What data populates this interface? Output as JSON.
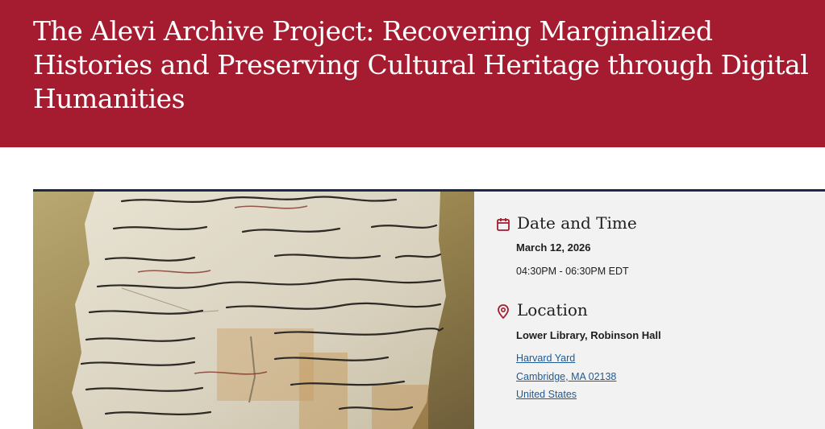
{
  "event": {
    "title": "The Alevi Archive Project: Recovering Marginalized Histories and Preserving Cultural Heritage through Digital Humanities"
  },
  "image": {
    "subject": "aged-manuscript-photo"
  },
  "date_time": {
    "heading": "Date and Time",
    "icon": "calendar-icon",
    "date": "March 12, 2026",
    "time": "04:30PM - 06:30PM EDT"
  },
  "location": {
    "heading": "Location",
    "icon": "map-pin-icon",
    "venue": "Lower Library, Robinson Hall",
    "address_line1": "Harvard Yard",
    "address_line2": "Cambridge, MA 02138",
    "country": "United States"
  },
  "colors": {
    "banner": "#a51c30",
    "accent_icon": "#a51c30",
    "rule": "#1e2a4a",
    "link": "#1e5a96",
    "details_bg": "#f2f2f2"
  }
}
